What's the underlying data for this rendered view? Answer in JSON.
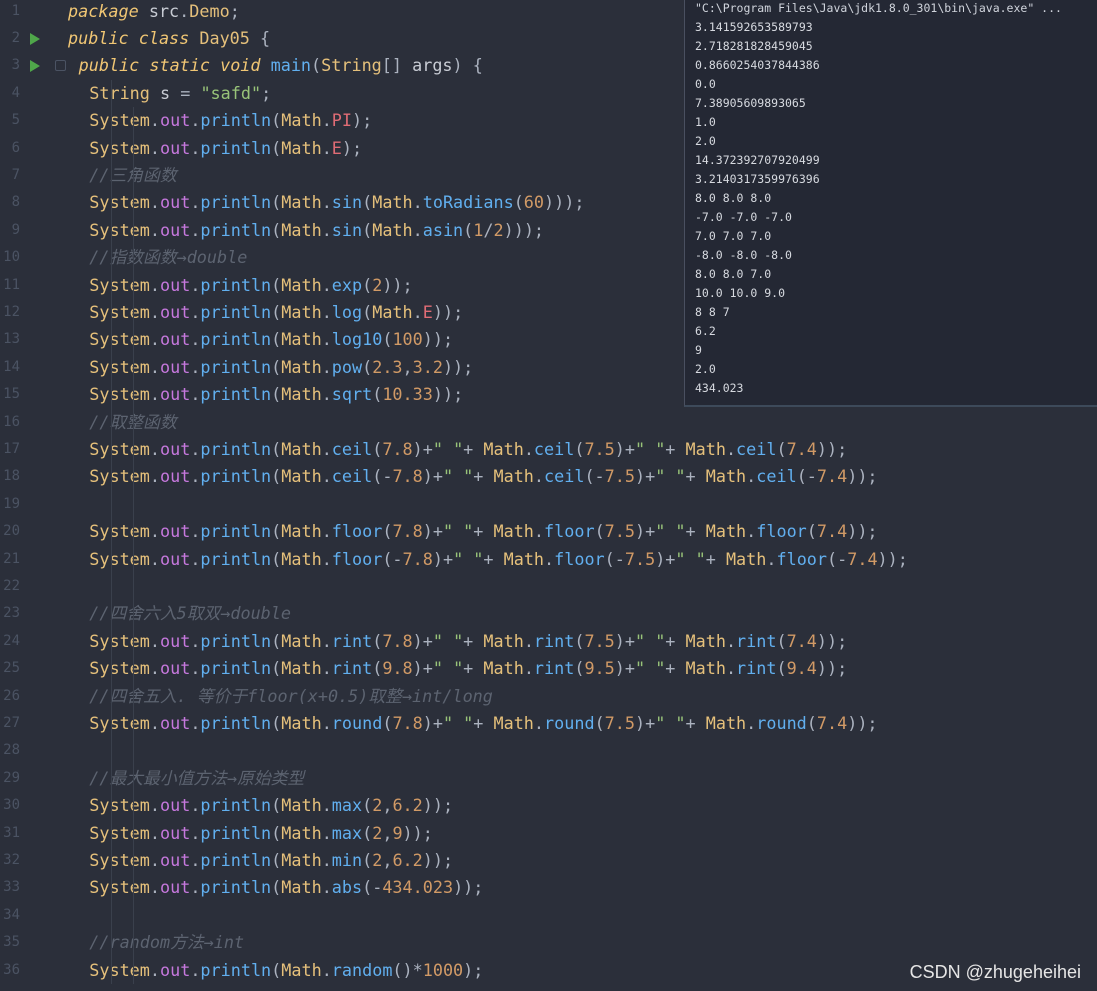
{
  "gutter": {
    "line_numbers": [
      "1",
      "2",
      "3",
      "4",
      "5",
      "6",
      "7",
      "8",
      "9",
      "10",
      "11",
      "12",
      "13",
      "14",
      "15",
      "16",
      "17",
      "18",
      "19",
      "20",
      "21",
      "22",
      "23",
      "24",
      "25",
      "26",
      "27",
      "28",
      "29",
      "30",
      "31",
      "32",
      "33",
      "34",
      "35",
      "36"
    ]
  },
  "code": {
    "lines": [
      "package src.Demo;",
      "public class Day05 {",
      "    public static void main(String[] args) {",
      "        String s = \"safd\";",
      "        System.out.println(Math.PI);",
      "        System.out.println(Math.E);",
      "        //三角函数",
      "        System.out.println(Math.sin(Math.toRadians(60)));",
      "        System.out.println(Math.sin(Math.asin(1/2)));",
      "        //指数函数→double",
      "        System.out.println(Math.exp(2));",
      "        System.out.println(Math.log(Math.E));",
      "        System.out.println(Math.log10(100));",
      "        System.out.println(Math.pow(2.3,3.2));",
      "        System.out.println(Math.sqrt(10.33));",
      "        //取整函数",
      "        System.out.println(Math.ceil(7.8)+\" \"+ Math.ceil(7.5)+\" \"+ Math.ceil(7.4));",
      "        System.out.println(Math.ceil(-7.8)+\" \"+ Math.ceil(-7.5)+\" \"+ Math.ceil(-7.4));",
      "",
      "        System.out.println(Math.floor(7.8)+\" \"+ Math.floor(7.5)+\" \"+ Math.floor(7.4));",
      "        System.out.println(Math.floor(-7.8)+\" \"+ Math.floor(-7.5)+\" \"+ Math.floor(-7.4));",
      "",
      "        //四舍六入5取双→double",
      "        System.out.println(Math.rint(7.8)+\" \"+ Math.rint(7.5)+\" \"+ Math.rint(7.4));",
      "        System.out.println(Math.rint(9.8)+\" \"+ Math.rint(9.5)+\" \"+ Math.rint(9.4));",
      "        //四舍五入. 等价于floor(x+0.5)取整→int/long",
      "        System.out.println(Math.round(7.8)+\" \"+ Math.round(7.5)+\" \"+ Math.round(7.4));",
      "",
      "        //最大最小值方法→原始类型",
      "        System.out.println(Math.max(2,6.2));",
      "        System.out.println(Math.max(2,9));",
      "        System.out.println(Math.min(2,6.2));",
      "        System.out.println(Math.abs(-434.023));",
      "",
      "        //random方法→int",
      "        System.out.println(Math.random()*1000);"
    ]
  },
  "console": {
    "title": "\"C:\\Program Files\\Java\\jdk1.8.0_301\\bin\\java.exe\" ...",
    "lines": [
      "3.141592653589793",
      "2.718281828459045",
      "0.8660254037844386",
      "0.0",
      "7.38905609893065",
      "1.0",
      "2.0",
      "14.372392707920499",
      "3.2140317359976396",
      "8.0 8.0 8.0",
      "-7.0 -7.0 -7.0",
      "7.0 7.0 7.0",
      "-8.0 -8.0 -8.0",
      "8.0 8.0 7.0",
      "10.0 10.0 9.0",
      "8 8 7",
      "6.2",
      "9",
      "2.0",
      "434.023"
    ]
  },
  "watermark": "CSDN @zhugeheihei",
  "icons": {
    "run": "run-gutter-icon",
    "fold": "fold-marker-icon"
  },
  "colors": {
    "background": "#2b2f3a",
    "console_bg": "#242834",
    "run_icon": "#4fa64a"
  }
}
